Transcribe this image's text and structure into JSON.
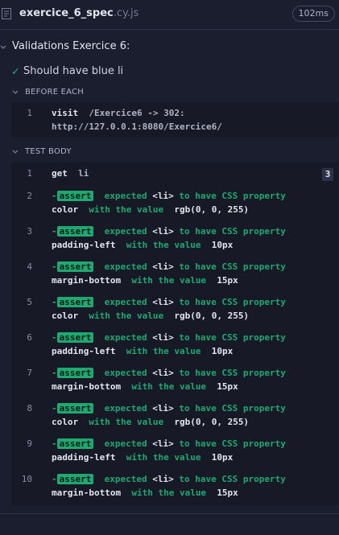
{
  "header": {
    "file_name": "exercice_6_spec",
    "file_ext": ".cy.js",
    "duration": "102ms"
  },
  "suite": {
    "title": "Validations Exercice 6:"
  },
  "test": {
    "title": "Should have blue li"
  },
  "before_each": {
    "label": "BEFORE EACH",
    "command": {
      "number": "1",
      "name": "visit",
      "message_line1": "/Exercice6 -> 302:",
      "message_line2": "http://127.0.0.1:8080/Exercice6/"
    }
  },
  "test_body": {
    "label": "TEST BODY",
    "get": {
      "number": "1",
      "name": "get",
      "selector": "li",
      "count": "3"
    },
    "asserts": [
      {
        "number": "2",
        "badge": "assert",
        "prefix": "-",
        "expected": "expected",
        "subject": "<li>",
        "verb": "to have CSS property",
        "property": "color",
        "with": "with the value",
        "value": "rgb(0, 0, 255)"
      },
      {
        "number": "3",
        "badge": "assert",
        "prefix": "-",
        "expected": "expected",
        "subject": "<li>",
        "verb": "to have CSS property",
        "property": "padding-left",
        "with": "with the value",
        "value": "10px"
      },
      {
        "number": "4",
        "badge": "assert",
        "prefix": "-",
        "expected": "expected",
        "subject": "<li>",
        "verb": "to have CSS property",
        "property": "margin-bottom",
        "with": "with the value",
        "value": "15px"
      },
      {
        "number": "5",
        "badge": "assert",
        "prefix": "-",
        "expected": "expected",
        "subject": "<li>",
        "verb": "to have CSS property",
        "property": "color",
        "with": "with the value",
        "value": "rgb(0, 0, 255)"
      },
      {
        "number": "6",
        "badge": "assert",
        "prefix": "-",
        "expected": "expected",
        "subject": "<li>",
        "verb": "to have CSS property",
        "property": "padding-left",
        "with": "with the value",
        "value": "10px"
      },
      {
        "number": "7",
        "badge": "assert",
        "prefix": "-",
        "expected": "expected",
        "subject": "<li>",
        "verb": "to have CSS property",
        "property": "margin-bottom",
        "with": "with the value",
        "value": "15px"
      },
      {
        "number": "8",
        "badge": "assert",
        "prefix": "-",
        "expected": "expected",
        "subject": "<li>",
        "verb": "to have CSS property",
        "property": "color",
        "with": "with the value",
        "value": "rgb(0, 0, 255)"
      },
      {
        "number": "9",
        "badge": "assert",
        "prefix": "-",
        "expected": "expected",
        "subject": "<li>",
        "verb": "to have CSS property",
        "property": "padding-left",
        "with": "with the value",
        "value": "10px"
      },
      {
        "number": "10",
        "badge": "assert",
        "prefix": "-",
        "expected": "expected",
        "subject": "<li>",
        "verb": "to have CSS property",
        "property": "margin-bottom",
        "with": "with the value",
        "value": "15px"
      }
    ]
  },
  "colors": {
    "background": "#1b1e2e",
    "passed": "#1fa971",
    "command_bg": "#171926"
  },
  "icons": {
    "file": "file-icon",
    "collapse": "chevron-down-icon",
    "passed": "check-icon"
  }
}
